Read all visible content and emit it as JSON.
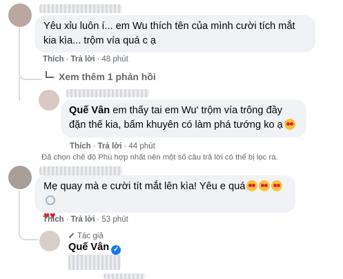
{
  "comments": [
    {
      "text": "Yêu xỉu luôn í... em Wu thích tên của mình cười tích mắt kia kìa... trộm vía quá c ạ",
      "actions": {
        "like": "Thích",
        "reply": "Trả lời",
        "time": "48 phút"
      }
    },
    {
      "view_more": "Xem thêm 1 phản hồi",
      "reply_author": "Quế Vân",
      "reply_text": "em thấy tai em Wu' trộm vía trông đầy đặn thế kia, bấm khuyên có làm phá tướng ko ạ",
      "actions": {
        "like": "Thích",
        "reply": "Trả lời",
        "time": "44 phút"
      }
    },
    {
      "filter_notice": "Đã chọn chế độ Phù hợp nhất nên một số câu trả lời có thể bị lọc ra.",
      "text": "Mẹ quay mà e cười tít mắt lên kìa! Yêu e quá",
      "hearts": "♥♥",
      "actions": {
        "like": "Thích",
        "reply": "Trả lời",
        "time": "53 phút"
      }
    }
  ],
  "author_reply": {
    "badge_label": "Tác giả",
    "author": "Quế Vân",
    "verified_mark": "✓"
  },
  "icons": [
    "pen-icon",
    "verified-icon",
    "heart-eyes-emoji",
    "hearts-emoji",
    "ring-emoji",
    "heart-icon"
  ],
  "colors": {
    "bubble": "#f0f2f5",
    "meta_text": "#65676b",
    "verified": "#1877f2",
    "heart": "#e41e3f"
  }
}
